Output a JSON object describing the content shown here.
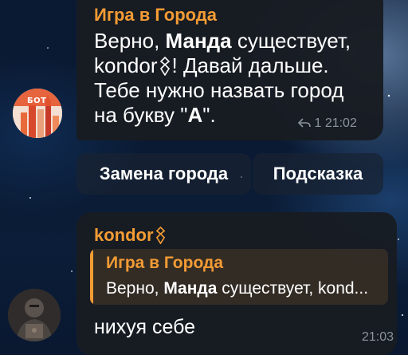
{
  "bot_message": {
    "sender": "Игра в Города",
    "line1_prefix": "Верно, ",
    "line1_bold": "Манда",
    "line1_suffix": " существует,",
    "line2_name": "kondor",
    "line2_rest": "! Давай дальше.",
    "line3": "Тебе нужно назвать город",
    "line4_prefix": "на букву \"",
    "line4_bold": "А",
    "line4_suffix": "\".",
    "views": "1",
    "time": "21:02",
    "bot_badge": "БОТ"
  },
  "keyboard": {
    "replace_label": "Замена города",
    "hint_label": "Подсказка"
  },
  "user_message": {
    "sender": "kondor",
    "reply_name": "Игра в Города",
    "reply_prefix": "Верно, ",
    "reply_bold": "Манда",
    "reply_suffix": " существует, kond...",
    "text": "нихуя себе",
    "time": "21:03"
  },
  "colors": {
    "accent": "#f39b34",
    "bubble": "#181c22",
    "meta": "#8b939c"
  },
  "icons": [
    "forward-arrow-icon",
    "premium-emoji-icon",
    "bot-avatar",
    "user-avatar"
  ]
}
